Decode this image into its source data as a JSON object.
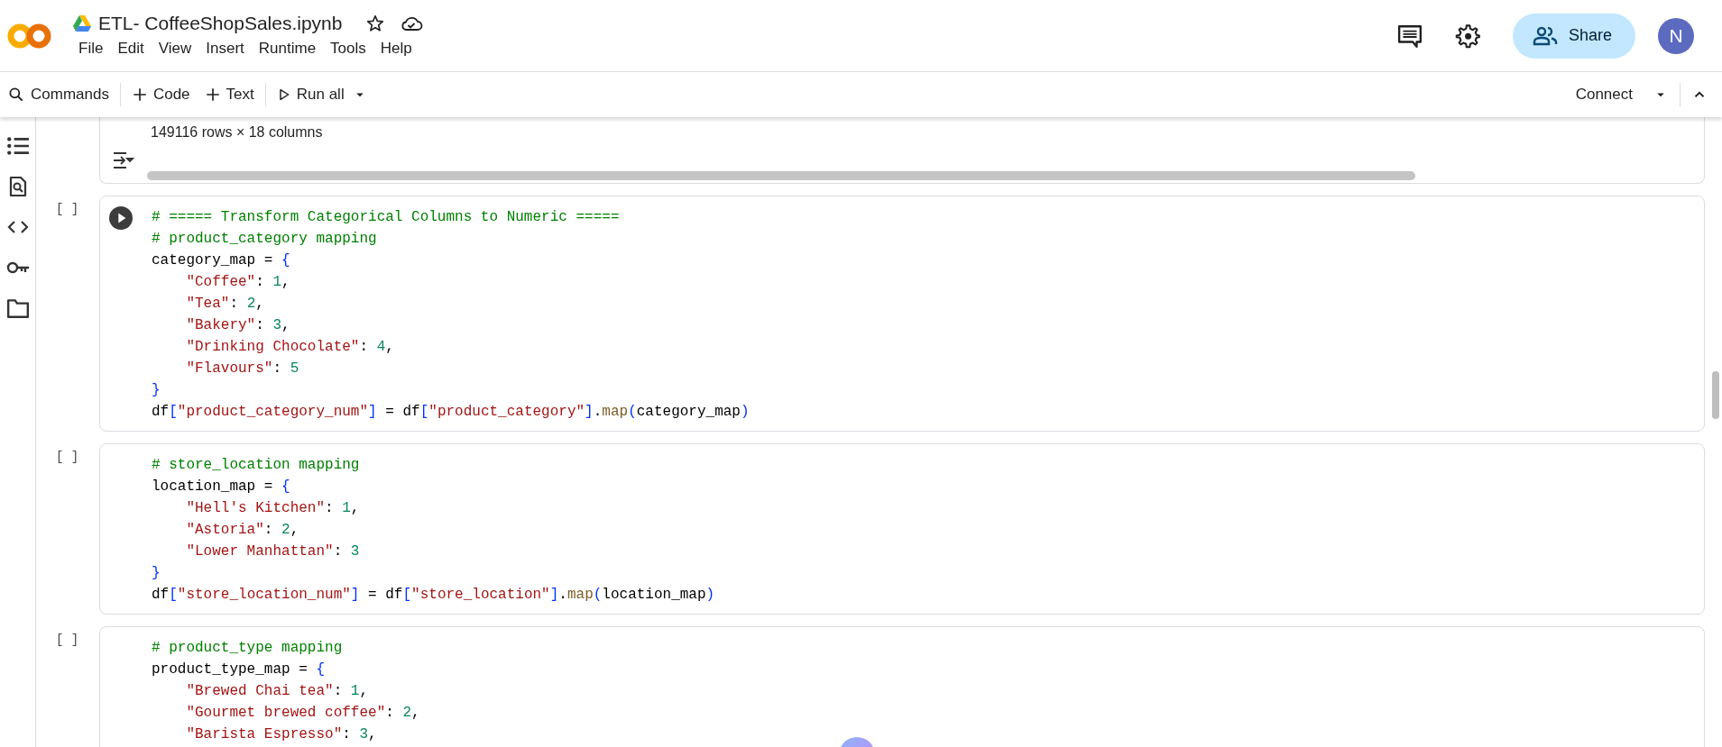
{
  "header": {
    "title": "ETL- CoffeeShopSales.ipynb",
    "menu": [
      "File",
      "Edit",
      "View",
      "Insert",
      "Runtime",
      "Tools",
      "Help"
    ],
    "share": "Share",
    "avatar": "N"
  },
  "toolbar": {
    "items": [
      {
        "label": "Commands",
        "kind": "search",
        "divider_before": false
      },
      {
        "label": "Code",
        "kind": "add",
        "divider_before": true
      },
      {
        "label": "Text",
        "kind": "add",
        "divider_before": false
      },
      {
        "label": "Run all",
        "kind": "run",
        "divider_before": true
      }
    ],
    "connect": "Connect"
  },
  "output": {
    "summary": "149116 rows × 18 columns"
  },
  "cells": [
    {
      "exec": "[ ]",
      "run_button": true,
      "lines": [
        {
          "indented": false,
          "tokens": [
            {
              "kind": "comment",
              "text": "# ===== Transform Categorical Columns to Numeric ====="
            }
          ]
        },
        {
          "indented": false,
          "tokens": [
            {
              "kind": "comment",
              "text": "# product_category mapping"
            }
          ]
        },
        {
          "indented": false,
          "tokens": [
            {
              "kind": "plain",
              "text": "category_map = "
            },
            {
              "kind": "bracket",
              "text": "{"
            }
          ]
        },
        {
          "indented": true,
          "tokens": [
            {
              "kind": "string",
              "text": "\"Coffee\""
            },
            {
              "kind": "plain",
              "text": ": "
            },
            {
              "kind": "number",
              "text": "1"
            },
            {
              "kind": "plain",
              "text": ","
            }
          ]
        },
        {
          "indented": true,
          "tokens": [
            {
              "kind": "string",
              "text": "\"Tea\""
            },
            {
              "kind": "plain",
              "text": ": "
            },
            {
              "kind": "number",
              "text": "2"
            },
            {
              "kind": "plain",
              "text": ","
            }
          ]
        },
        {
          "indented": true,
          "tokens": [
            {
              "kind": "string",
              "text": "\"Bakery\""
            },
            {
              "kind": "plain",
              "text": ": "
            },
            {
              "kind": "number",
              "text": "3"
            },
            {
              "kind": "plain",
              "text": ","
            }
          ]
        },
        {
          "indented": true,
          "tokens": [
            {
              "kind": "string",
              "text": "\"Drinking Chocolate\""
            },
            {
              "kind": "plain",
              "text": ": "
            },
            {
              "kind": "number",
              "text": "4"
            },
            {
              "kind": "plain",
              "text": ","
            }
          ]
        },
        {
          "indented": true,
          "tokens": [
            {
              "kind": "string",
              "text": "\"Flavours\""
            },
            {
              "kind": "plain",
              "text": ": "
            },
            {
              "kind": "number",
              "text": "5"
            }
          ]
        },
        {
          "indented": false,
          "tokens": [
            {
              "kind": "bracket",
              "text": "}"
            }
          ]
        },
        {
          "indented": false,
          "tokens": [
            {
              "kind": "plain",
              "text": "df"
            },
            {
              "kind": "bracket",
              "text": "["
            },
            {
              "kind": "string",
              "text": "\"product_category_num\""
            },
            {
              "kind": "bracket",
              "text": "]"
            },
            {
              "kind": "plain",
              "text": " = df"
            },
            {
              "kind": "bracket",
              "text": "["
            },
            {
              "kind": "string",
              "text": "\"product_category\""
            },
            {
              "kind": "bracket",
              "text": "]"
            },
            {
              "kind": "plain",
              "text": "."
            },
            {
              "kind": "func",
              "text": "map"
            },
            {
              "kind": "bracket",
              "text": "("
            },
            {
              "kind": "plain",
              "text": "category_map"
            },
            {
              "kind": "bracket",
              "text": ")"
            }
          ]
        }
      ]
    },
    {
      "exec": "[ ]",
      "run_button": false,
      "lines": [
        {
          "indented": false,
          "tokens": [
            {
              "kind": "comment",
              "text": "# store_location mapping"
            }
          ]
        },
        {
          "indented": false,
          "tokens": [
            {
              "kind": "plain",
              "text": "location_map = "
            },
            {
              "kind": "bracket",
              "text": "{"
            }
          ]
        },
        {
          "indented": true,
          "tokens": [
            {
              "kind": "string",
              "text": "\"Hell's Kitchen\""
            },
            {
              "kind": "plain",
              "text": ": "
            },
            {
              "kind": "number",
              "text": "1"
            },
            {
              "kind": "plain",
              "text": ","
            }
          ]
        },
        {
          "indented": true,
          "tokens": [
            {
              "kind": "string",
              "text": "\"Astoria\""
            },
            {
              "kind": "plain",
              "text": ": "
            },
            {
              "kind": "number",
              "text": "2"
            },
            {
              "kind": "plain",
              "text": ","
            }
          ]
        },
        {
          "indented": true,
          "tokens": [
            {
              "kind": "string",
              "text": "\"Lower Manhattan\""
            },
            {
              "kind": "plain",
              "text": ": "
            },
            {
              "kind": "number",
              "text": "3"
            }
          ]
        },
        {
          "indented": false,
          "tokens": [
            {
              "kind": "bracket",
              "text": "}"
            }
          ]
        },
        {
          "indented": false,
          "tokens": [
            {
              "kind": "plain",
              "text": "df"
            },
            {
              "kind": "bracket",
              "text": "["
            },
            {
              "kind": "string",
              "text": "\"store_location_num\""
            },
            {
              "kind": "bracket",
              "text": "]"
            },
            {
              "kind": "plain",
              "text": " = df"
            },
            {
              "kind": "bracket",
              "text": "["
            },
            {
              "kind": "string",
              "text": "\"store_location\""
            },
            {
              "kind": "bracket",
              "text": "]"
            },
            {
              "kind": "plain",
              "text": "."
            },
            {
              "kind": "func",
              "text": "map"
            },
            {
              "kind": "bracket",
              "text": "("
            },
            {
              "kind": "plain",
              "text": "location_map"
            },
            {
              "kind": "bracket",
              "text": ")"
            }
          ]
        }
      ]
    },
    {
      "exec": "[ ]",
      "run_button": false,
      "lines": [
        {
          "indented": false,
          "tokens": [
            {
              "kind": "comment",
              "text": "# product_type mapping"
            }
          ]
        },
        {
          "indented": false,
          "tokens": [
            {
              "kind": "plain",
              "text": "product_type_map = "
            },
            {
              "kind": "bracket",
              "text": "{"
            }
          ]
        },
        {
          "indented": true,
          "tokens": [
            {
              "kind": "string",
              "text": "\"Brewed Chai tea\""
            },
            {
              "kind": "plain",
              "text": ": "
            },
            {
              "kind": "number",
              "text": "1"
            },
            {
              "kind": "plain",
              "text": ","
            }
          ]
        },
        {
          "indented": true,
          "tokens": [
            {
              "kind": "string",
              "text": "\"Gourmet brewed coffee\""
            },
            {
              "kind": "plain",
              "text": ": "
            },
            {
              "kind": "number",
              "text": "2"
            },
            {
              "kind": "plain",
              "text": ","
            }
          ]
        },
        {
          "indented": true,
          "tokens": [
            {
              "kind": "string",
              "text": "\"Barista Espresso\""
            },
            {
              "kind": "plain",
              "text": ": "
            },
            {
              "kind": "number",
              "text": "3"
            },
            {
              "kind": "plain",
              "text": ","
            }
          ]
        }
      ]
    }
  ]
}
